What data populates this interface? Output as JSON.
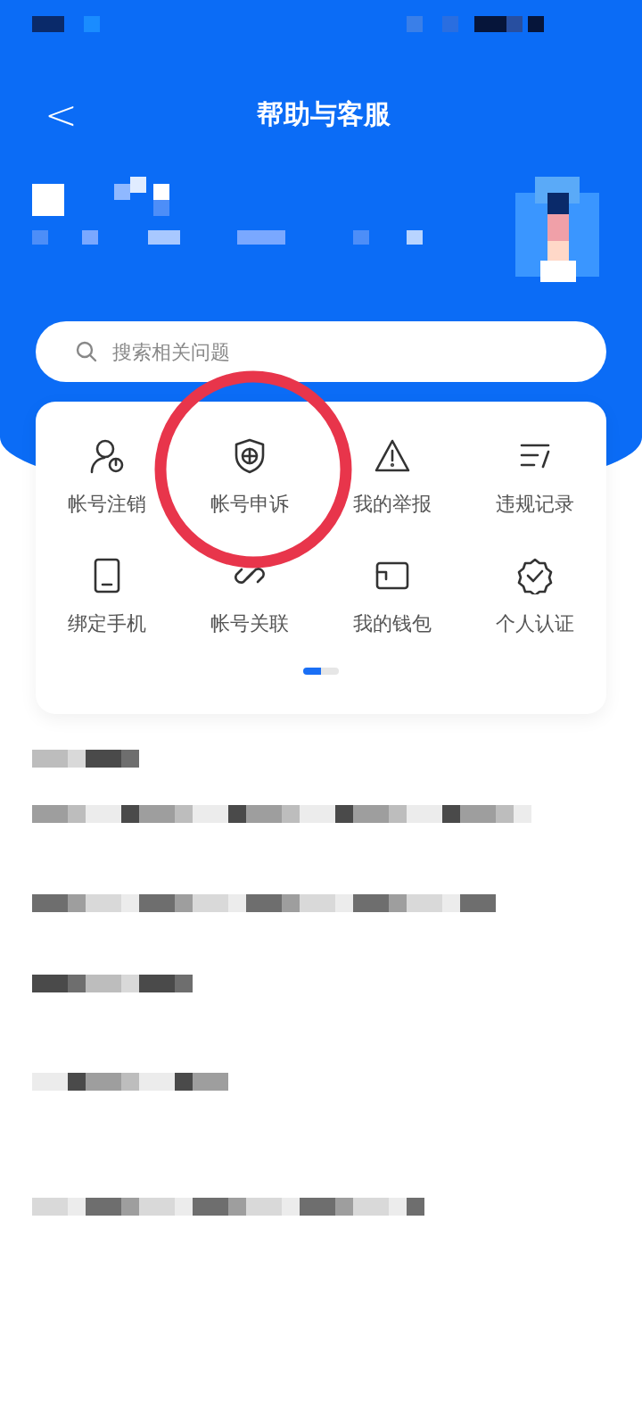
{
  "header": {
    "back": "<",
    "title": "帮助与客服"
  },
  "search": {
    "placeholder": "搜索相关问题"
  },
  "services": [
    {
      "label": "帐号注销"
    },
    {
      "label": "帐号申诉"
    },
    {
      "label": "我的举报"
    },
    {
      "label": "违规记录"
    },
    {
      "label": "绑定手机"
    },
    {
      "label": "帐号关联"
    },
    {
      "label": "我的钱包"
    },
    {
      "label": "个人认证"
    }
  ],
  "pager": [
    {
      "selected": true
    },
    {
      "selected": false
    }
  ]
}
